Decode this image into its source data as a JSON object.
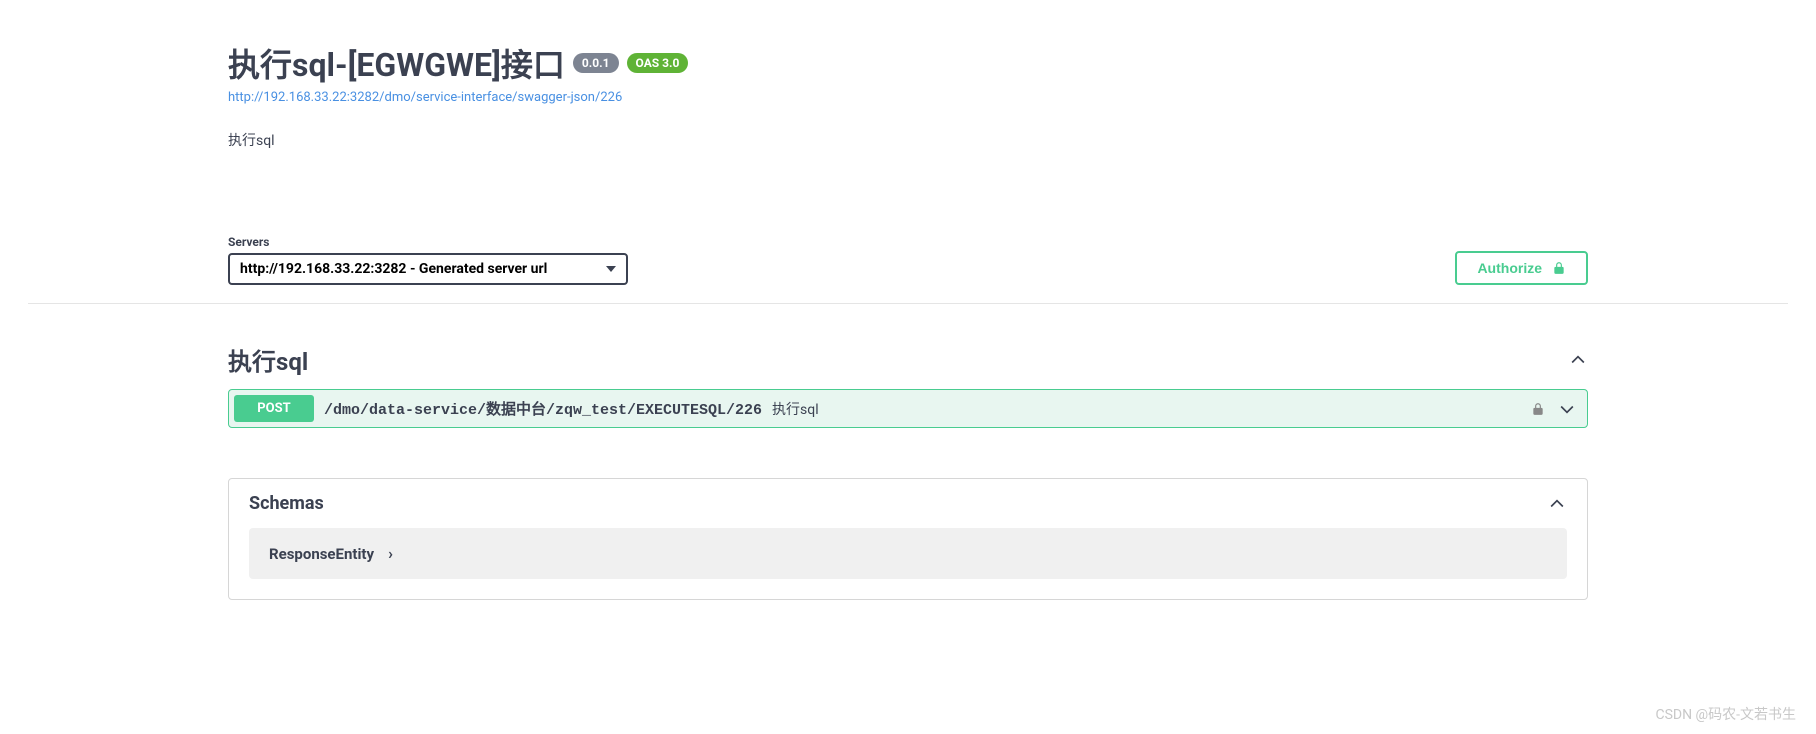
{
  "header": {
    "title": "执行sql-[EGWGWE]接口",
    "version_badge": "0.0.1",
    "oas_badge": "OAS 3.0",
    "json_url": "http://192.168.33.22:3282/dmo/service-interface/swagger-json/226",
    "description": "执行sql"
  },
  "servers": {
    "label": "Servers",
    "selected": "http://192.168.33.22:3282 - Generated server url"
  },
  "authorize_label": "Authorize",
  "tag": {
    "name": "执行sql"
  },
  "operation": {
    "method": "POST",
    "path": "/dmo/data-service/数据中台/zqw_test/EXECUTESQL/226",
    "summary": "执行sql"
  },
  "schemas": {
    "title": "Schemas",
    "items": [
      {
        "name": "ResponseEntity"
      }
    ]
  },
  "watermark": "CSDN @码农-文若书生"
}
